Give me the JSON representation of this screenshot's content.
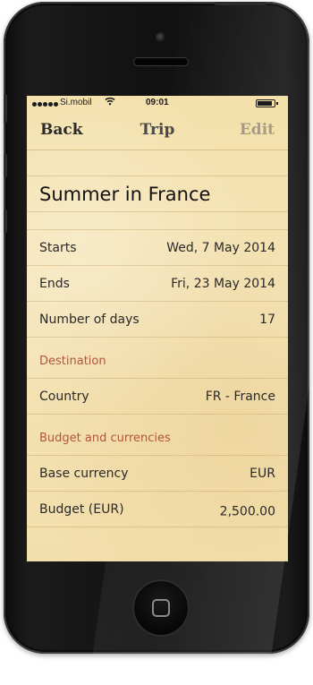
{
  "status": {
    "carrier": "Si.mobil",
    "time": "09:01"
  },
  "navbar": {
    "back_label": "Back",
    "title": "Trip",
    "edit_label": "Edit"
  },
  "trip": {
    "name": "Summer in France"
  },
  "dates": [
    {
      "label": "Starts",
      "value": "Wed, 7 May 2014"
    },
    {
      "label": "Ends",
      "value": "Fri, 23 May 2014"
    },
    {
      "label": "Number of days",
      "value": "17"
    }
  ],
  "destination": {
    "header": "Destination",
    "country_label": "Country",
    "country_value": "FR - France"
  },
  "budget": {
    "header": "Budget and currencies",
    "base_currency_label": "Base currency",
    "base_currency_value": "EUR",
    "budget_label": "Budget (EUR)",
    "budget_value": "2,500.00"
  },
  "colors": {
    "section_header": "#b2553b",
    "paper": "#f4e0aa"
  },
  "icons": [
    "signal-dots-icon",
    "wifi-icon",
    "battery-icon"
  ]
}
